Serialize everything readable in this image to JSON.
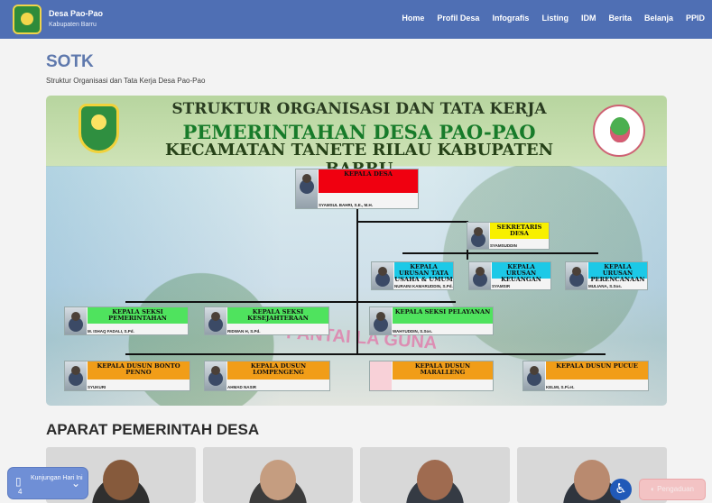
{
  "header": {
    "title": "Desa Pao-Pao",
    "subtitle": "Kabupaten Barru",
    "nav": [
      "Home",
      "Profil Desa",
      "Infografis",
      "Listing",
      "IDM",
      "Berita",
      "Belanja",
      "PPID"
    ]
  },
  "page": {
    "title": "SOTK",
    "subtitle": "Struktur Organisasi dan Tata Kerja Desa Pao-Pao"
  },
  "banner": {
    "line1": "STRUKTUR ORGANISASI DAN TATA KERJA",
    "line2": "PEMERINTAHAN DESA PAO-PAO",
    "line3": "KECAMATAN TANETE RILAU KABUPATEN BARRU",
    "watermark": "PANTAI LA GUNA"
  },
  "org": {
    "kepala": {
      "title": "KEPALA DESA",
      "name": "SYAMSUL BAHRI, S.E., M.H."
    },
    "sekretaris": {
      "title": "SEKRETARIS DESA",
      "name": "SYAMSUDDIN"
    },
    "urusan": [
      {
        "title": "KEPALA URUSAN TATA USAHA & UMUM",
        "name": "NURAINI KAMARUDDIN, S.Pd."
      },
      {
        "title": "KEPALA URUSAN KEUANGAN",
        "name": "SYAMSIR"
      },
      {
        "title": "KEPALA URUSAN PERENCANAAN",
        "name": "MULIANA, S.Sos."
      }
    ],
    "seksi": [
      {
        "title": "KEPALA SEKSI PEMERINTAHAN",
        "name": "M. ISHAQ FADALI, S.Pd."
      },
      {
        "title": "KEPALA SEKSI KESEJAHTERAAN",
        "name": "RIDWAN H, S.Pd."
      },
      {
        "title": "KEPALA SEKSI PELAYANAN",
        "name": "WAHYUDDIN, S.Sos."
      }
    ],
    "dusun": [
      {
        "title": "KEPALA DUSUN BONTO PENNO",
        "name": "SYUKURI"
      },
      {
        "title": "KEPALA DUSUN LOMPENGENG",
        "name": "AHMAD NASIR"
      },
      {
        "title": "KEPALA DUSUN MARALLENG",
        "name": ""
      },
      {
        "title": "KEPALA DUSUN PUCUE",
        "name": "KELMI, S.Pi.et."
      }
    ]
  },
  "aparat": {
    "title": "APARAT PEMERINTAH DESA"
  },
  "widgets": {
    "visit_label": "Kunjungan Hari Ini",
    "visit_count": "4",
    "complaint": "Pengaduan"
  }
}
